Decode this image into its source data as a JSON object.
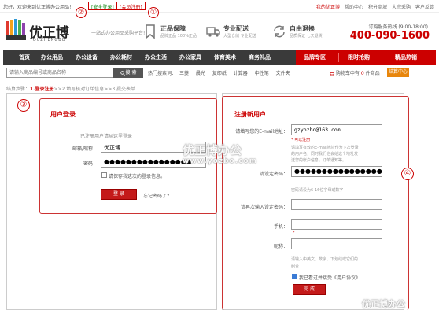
{
  "topbar": {
    "greeting": "您好，欢迎来到优正博办公用品！",
    "login_link": "[安全登录]",
    "register_link": "[会员注册]",
    "links": [
      "我的优正博",
      "帮助中心",
      "积分商城",
      "大宗采购",
      "客户反馈"
    ]
  },
  "annotations": {
    "one": "①",
    "two": "②",
    "three": "③",
    "four": "④"
  },
  "header": {
    "logo_cn": "优正博",
    "logo_en": "YOUZHENGBO",
    "slogan": "一站式办公用品采购平台!",
    "features": [
      {
        "title": "正品保障",
        "sub": "品牌正品 100%正品"
      },
      {
        "title": "专业配送",
        "sub": "大型仓储 专业配送"
      },
      {
        "title": "自由退换",
        "sub": "品质保证 七天退货"
      }
    ],
    "hotline_label": "订购服务热线 (9:00-18:00)",
    "hotline": "400-090-1600"
  },
  "nav": {
    "items": [
      "首页",
      "办公用品",
      "办公设备",
      "办公耗材",
      "办公生活",
      "办公家具",
      "体育美术",
      "商务礼品"
    ],
    "right_items": [
      "品牌专区",
      "限时抢购",
      "精品热销"
    ]
  },
  "search": {
    "placeholder": "请输入商品编号或商品名称",
    "button": "搜 索",
    "hot_label": "热门搜索词：",
    "hot_terms": [
      "三菱",
      "晨光",
      "复印纸",
      "计算器",
      "中性笔",
      "文件夹"
    ],
    "cart_prefix": "购物车中有",
    "cart_count": "0",
    "cart_suffix": "件商品",
    "checkout": "结算中心"
  },
  "steps": {
    "prefix": "结算步骤：",
    "step1": "1.登录注册",
    "step2": ">>2.填写核对订单信息",
    "step3": ">>3.提交表单"
  },
  "login": {
    "title": "用户登录",
    "subtitle": "已注册用户请从这里登录",
    "email_label": "邮箱/昵称：",
    "email_value": "优正博",
    "password_label": "密码：",
    "password_value": "●●●●●●●●●●●●●●●●",
    "remember": "请保存我这次的登录信息。",
    "login_button": "登  录",
    "forgot": "忘记密码了?"
  },
  "register": {
    "title": "注册新用户",
    "email_label": "请填写您的E-mail地址：",
    "email_value": "gzyozbo@163.com",
    "required_note": "* 可以注册",
    "email_hint1": "请填写有效的E-mail地址作为下次登录",
    "email_hint2": "的用户名，同时我们也会给这个地址发",
    "email_hint3": "送您的帐户信息，订单通知等。",
    "password_label": "请设定密码：",
    "password_value": "●●●●●●●●●●●●●●●●",
    "password_hint": "密码请设为6-16位字母或数字",
    "confirm_label": "请再次输入设定密码：",
    "phone_label": "手机：",
    "nickname_label": "昵称：",
    "star": "*",
    "nickname_hint1": "请输入中英文、数字、下划线或它们的",
    "nickname_hint2": "组合",
    "agree": "我已看过并接受《用户协议》",
    "submit": "完  成"
  },
  "watermark": {
    "cn": "优正博办公",
    "url": "www.yozbo.com",
    "bottom": "优正博办公"
  }
}
